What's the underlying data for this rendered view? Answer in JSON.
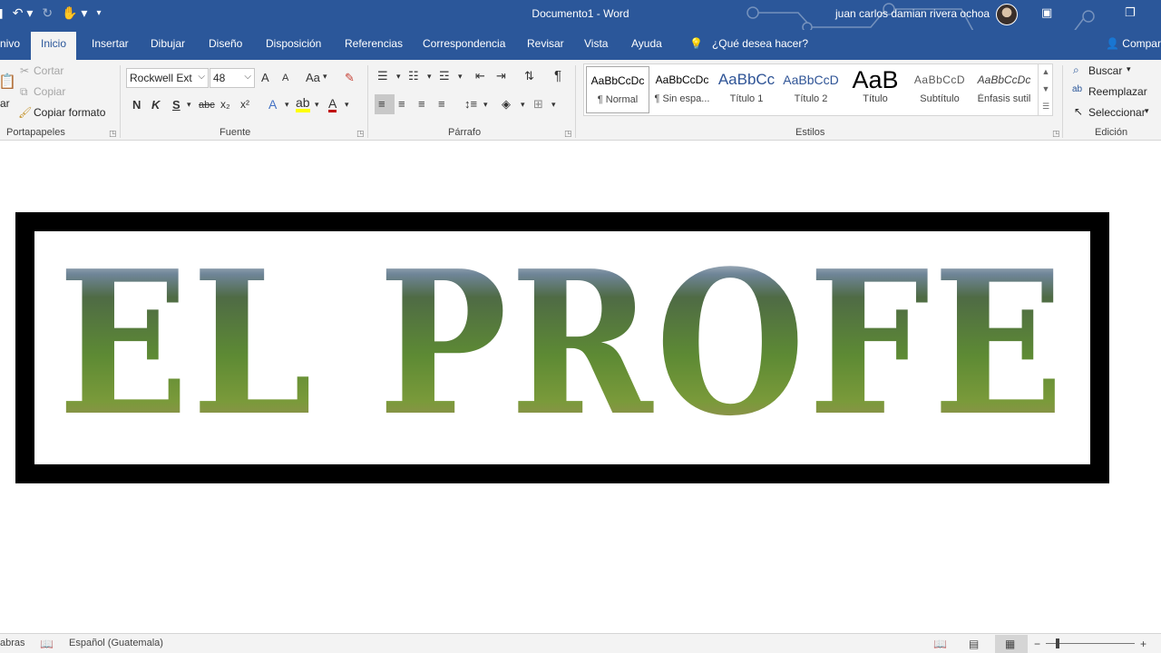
{
  "window": {
    "title": "Documento1  -  Word",
    "user": "juan carlos damian rivera ochoa"
  },
  "tabs": [
    {
      "label": "nivo"
    },
    {
      "label": "Inicio"
    },
    {
      "label": "Insertar"
    },
    {
      "label": "Dibujar"
    },
    {
      "label": "Diseño"
    },
    {
      "label": "Disposición"
    },
    {
      "label": "Referencias"
    },
    {
      "label": "Correspondencia"
    },
    {
      "label": "Revisar"
    },
    {
      "label": "Vista"
    },
    {
      "label": "Ayuda"
    }
  ],
  "active_tab": "Inicio",
  "tell_me": "¿Qué desea hacer?",
  "share_label": "Compar",
  "clipboard": {
    "group_label": "Portapapeles",
    "paste_partial": "ar",
    "cut": "Cortar",
    "copy": "Copiar",
    "format_painter": "Copiar formato"
  },
  "font": {
    "group_label": "Fuente",
    "font_name": "Rockwell Ext",
    "font_size": "48",
    "grow": "A",
    "shrink": "A",
    "case": "Aa",
    "bold": "N",
    "italic": "K",
    "underline": "S",
    "strike": "abc",
    "subscript": "x₂",
    "superscript": "x²",
    "text_effects": "A",
    "font_color": "A"
  },
  "paragraph": {
    "group_label": "Párrafo",
    "pilcrow": "¶"
  },
  "styles": {
    "group_label": "Estilos",
    "items": [
      {
        "sample": "AaBbCcDc",
        "name": "¶ Normal"
      },
      {
        "sample": "AaBbCcDc",
        "name": "¶ Sin espa..."
      },
      {
        "sample": "AaBbCc",
        "name": "Título 1"
      },
      {
        "sample": "AaBbCcD",
        "name": "Título 2"
      },
      {
        "sample": "AaB",
        "name": "Título"
      },
      {
        "sample": "AaBbCcD",
        "name": "Subtítulo"
      },
      {
        "sample": "AaBbCcDc",
        "name": "Énfasis sutil"
      }
    ]
  },
  "editing": {
    "group_label": "Edición",
    "find": "Buscar",
    "replace": "Reemplazar",
    "select": "Seleccionar"
  },
  "document": {
    "banner_text": "EL PROFE"
  },
  "status": {
    "words_partial": "abras",
    "language": "Español (Guatemala)",
    "zoom_minus": "−",
    "zoom_plus": "+"
  },
  "colors": {
    "brand_blue": "#2b579a",
    "ribbon_bg": "#f3f3f3",
    "frame": "#000000"
  }
}
